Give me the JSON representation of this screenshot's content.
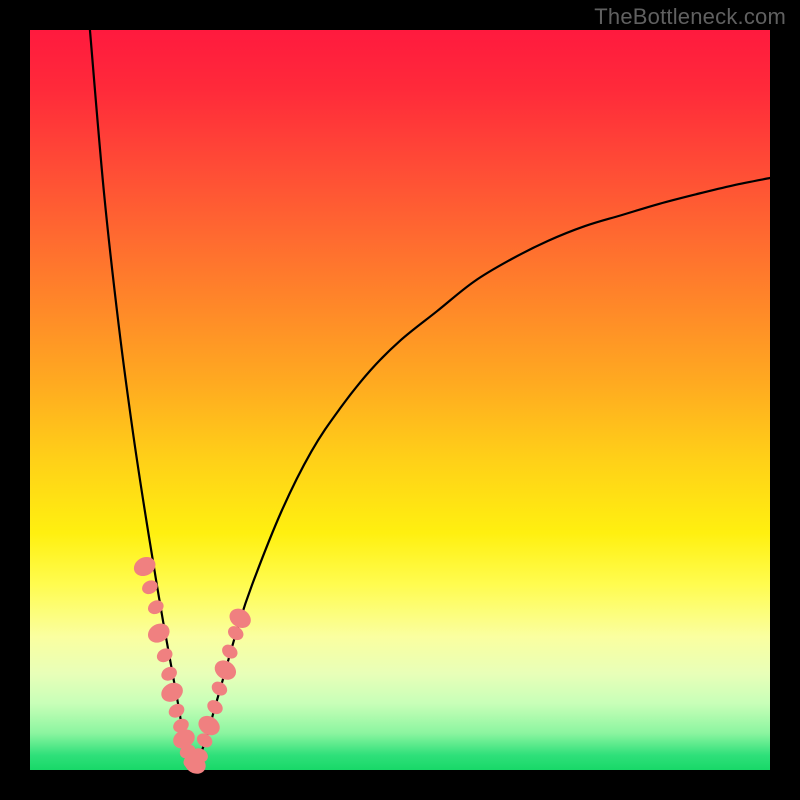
{
  "watermark": "TheBottleneck.com",
  "chart_data": {
    "type": "line",
    "title": "",
    "xlabel": "",
    "ylabel": "",
    "xlim": [
      0,
      100
    ],
    "ylim": [
      0,
      100
    ],
    "grid": false,
    "legend": null,
    "description": "Asymmetric V-shaped bottleneck curve on rainbow gradient. Minimum (0%) near x≈22. Left branch rises to ~100% at x≈8; right branch rises slowly, approaching ~80% at x=100.",
    "series": [
      {
        "name": "curve",
        "color": "#000000",
        "x": [
          8.1,
          10,
          12,
          14,
          16,
          18,
          20,
          21,
          22,
          23,
          24,
          26,
          28,
          30,
          34,
          38,
          42,
          46,
          50,
          55,
          60,
          65,
          70,
          75,
          80,
          85,
          90,
          95,
          100
        ],
        "values": [
          100,
          78,
          60,
          45,
          32,
          20,
          9,
          3,
          0,
          2,
          5,
          12,
          19,
          25,
          35,
          43,
          49,
          54,
          58,
          62,
          66,
          69,
          71.5,
          73.5,
          75,
          76.5,
          77.8,
          79,
          80
        ]
      },
      {
        "name": "markers",
        "type": "scatter",
        "color": "#f08080",
        "x": [
          15.5,
          16.2,
          17.0,
          17.4,
          18.2,
          18.8,
          19.2,
          19.8,
          20.4,
          20.8,
          21.3,
          21.8,
          22.3,
          23.0,
          23.6,
          24.2,
          25.0,
          25.6,
          26.4,
          27.0,
          27.8,
          28.4
        ],
        "values": [
          27.5,
          24.7,
          22.0,
          18.5,
          15.5,
          13.0,
          10.5,
          8.0,
          6.0,
          4.2,
          2.5,
          1.2,
          0.8,
          2.0,
          4.0,
          6.0,
          8.5,
          11.0,
          13.5,
          16.0,
          18.5,
          20.5
        ]
      }
    ]
  }
}
